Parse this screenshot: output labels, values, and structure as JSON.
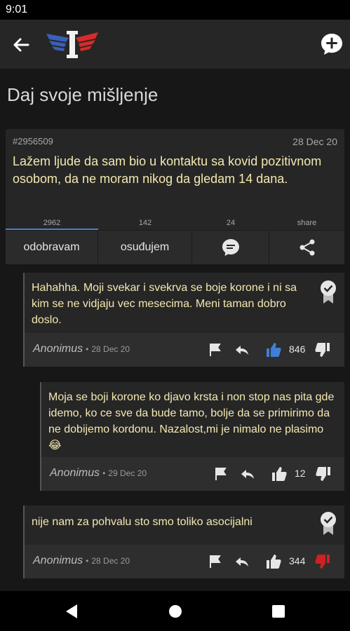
{
  "status_bar": {
    "time": "9:01"
  },
  "page": {
    "title": "Daj svoje mišljenje"
  },
  "post": {
    "id": "#2956509",
    "date": "28 Dec 20",
    "text": "Lažem ljude da sam bio u kontaktu sa kovid pozitivnom osobom, da ne moram nikog da gledam 14 dana.",
    "stats": [
      "2962",
      "142",
      "24",
      "share"
    ],
    "actions": {
      "approve": "odobravam",
      "condemn": "osuđujem"
    }
  },
  "comments": [
    {
      "text": "Hahahha. Moji svekar i svekrva se boje korone i ni sa kim se ne vidjaju vec mesecima. Meni taman dobro doslo.",
      "author": "Anonimus",
      "date": "28 Dec 20",
      "likes": "846",
      "liked": true,
      "disliked": false
    },
    {
      "text": "Moja se boji korone ko djavo krsta i non stop nas pita gde idemo, ko ce sve da bude tamo, bolje da se primirimo da ne dobijemo kordonu. Nazalost,mi je nimalo ne plasimo 😂",
      "author": "Anonimus",
      "date": "29 Dec 20",
      "likes": "12",
      "liked": false,
      "disliked": false
    },
    {
      "text": "nije nam za pohvalu sto smo toliko asocijalni",
      "author": "Anonimus",
      "date": "28 Dec 20",
      "likes": "344",
      "liked": false,
      "disliked": true
    }
  ],
  "colors": {
    "like_active": "#3f7fd6",
    "dislike_active": "#d02020",
    "text_accent": "#f4e8b0"
  }
}
